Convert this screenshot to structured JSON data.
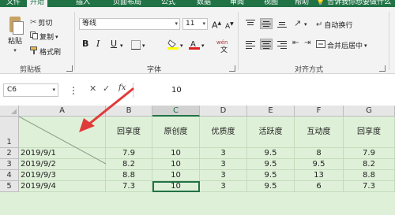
{
  "ribbon_tabs": [
    "文件",
    "开始",
    "插入",
    "页面布局",
    "公式",
    "数据",
    "审阅",
    "视图",
    "帮助"
  ],
  "tell_me": "告诉我你想要做什么",
  "clipboard": {
    "paste": "粘贴",
    "cut": "剪切",
    "copy": "复制",
    "format_painter": "格式刷",
    "group_label": "剪贴板"
  },
  "font": {
    "font_name": "等线",
    "font_size": "11",
    "increase_size": "A",
    "decrease_size": "A",
    "bold": "B",
    "italic": "I",
    "underline": "U",
    "phonetic": "wén",
    "group_label": "字体"
  },
  "alignment": {
    "wrap_text": "自动换行",
    "merge_center": "合并后居中",
    "group_label": "对齐方式"
  },
  "formula_bar": {
    "name_box": "C6",
    "fx": "fx",
    "cancel": "✕",
    "enter": "✓",
    "value": "10"
  },
  "sheet": {
    "columns": [
      "A",
      "B",
      "C",
      "D",
      "E",
      "F",
      "G"
    ],
    "selected_column": "C",
    "rows": [
      "1",
      "2",
      "3",
      "4",
      "5"
    ],
    "headers": [
      "",
      "回享度",
      "原创度",
      "优质度",
      "活跃度",
      "互动度",
      "回享度"
    ],
    "data": [
      [
        "2019/9/1",
        "7.9",
        "10",
        "3",
        "9.5",
        "8",
        "7.9"
      ],
      [
        "2019/9/2",
        "8.2",
        "10",
        "3",
        "9.5",
        "9.5",
        "8.2"
      ],
      [
        "2019/9/3",
        "8.8",
        "10",
        "3",
        "9.5",
        "13",
        "8.8"
      ],
      [
        "2019/9/4",
        "7.3",
        "10",
        "3",
        "9.5",
        "6",
        "7.3"
      ]
    ]
  },
  "colors": {
    "excel_green": "#217346",
    "cell_fill": "#dff0d8",
    "annotation_arrow": "#e03b3b"
  }
}
